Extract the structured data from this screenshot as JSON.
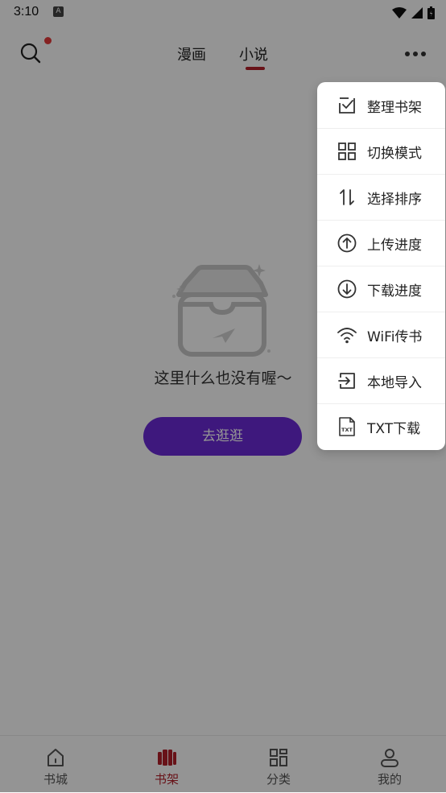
{
  "status_bar": {
    "time": "3:10",
    "notification_icon": "A"
  },
  "header": {
    "search_icon": "search-icon",
    "tabs": [
      {
        "label": "漫画",
        "active": false
      },
      {
        "label": "小说",
        "active": true
      }
    ],
    "accent_color": "#b3202a"
  },
  "empty_state": {
    "message": "这里什么也没有喔～",
    "button_label": "去逛逛",
    "button_color": "#6b2ad8"
  },
  "bottom_nav": {
    "items": [
      {
        "label": "书城",
        "icon": "home-icon",
        "active": false
      },
      {
        "label": "书架",
        "icon": "bookshelf-icon",
        "active": true
      },
      {
        "label": "分类",
        "icon": "grid-icon",
        "active": false
      },
      {
        "label": "我的",
        "icon": "user-icon",
        "active": false
      }
    ]
  },
  "menu": {
    "items": [
      {
        "label": "整理书架",
        "icon": "checkbox-edit-icon"
      },
      {
        "label": "切换模式",
        "icon": "grid-layout-icon"
      },
      {
        "label": "选择排序",
        "icon": "sort-icon"
      },
      {
        "label": "上传进度",
        "icon": "upload-circle-icon"
      },
      {
        "label": "下载进度",
        "icon": "download-circle-icon"
      },
      {
        "label": "WiFi传书",
        "icon": "wifi-icon"
      },
      {
        "label": "本地导入",
        "icon": "import-icon"
      },
      {
        "label": "TXT下载",
        "icon": "txt-file-icon"
      }
    ]
  }
}
